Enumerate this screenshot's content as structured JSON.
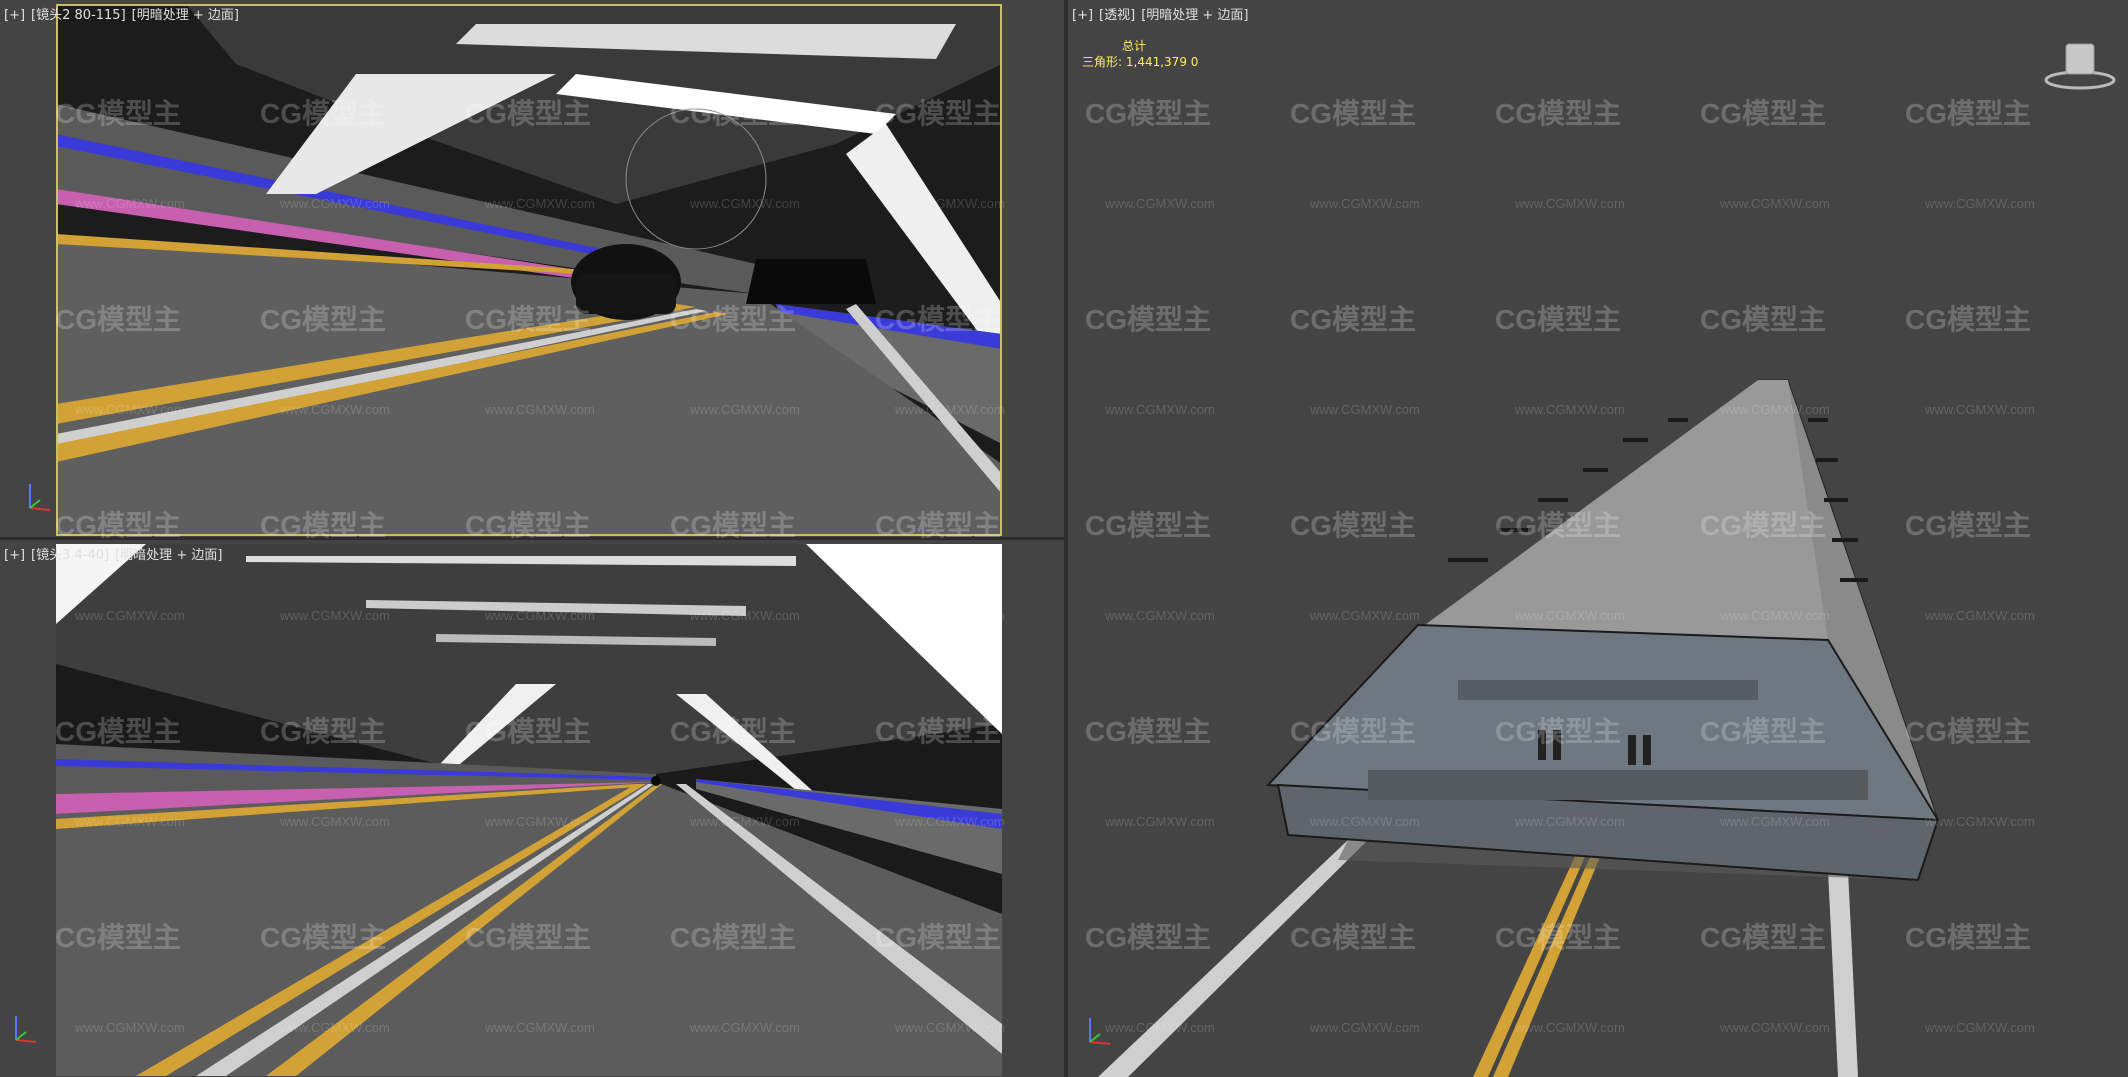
{
  "viewports": {
    "top_left": {
      "plus": "[+]",
      "camera": "[镜头2 80-115]",
      "shading": "[明暗处理 + 边面]"
    },
    "bottom_left": {
      "plus": "[+]",
      "camera": "[镜头3 4-40]",
      "shading": "[明暗处理 + 边面]"
    },
    "right": {
      "plus": "[+]",
      "camera": "[透视]",
      "shading": "[明暗处理 + 边面]"
    }
  },
  "stats": {
    "total_label": "总计",
    "triangles_label": "三角形:",
    "triangles_value": "1,441,379",
    "triangles_extra": "0"
  },
  "watermark": {
    "logo": "CG模型主",
    "url": "www.CGMXW.com"
  },
  "icons": {
    "nav_cube": "viewcube-icon",
    "axis": "axis-tripod-icon"
  },
  "colors": {
    "viewport_bg": "#444444",
    "active_border": "#c9c25f",
    "stats_text": "#ffee66"
  }
}
